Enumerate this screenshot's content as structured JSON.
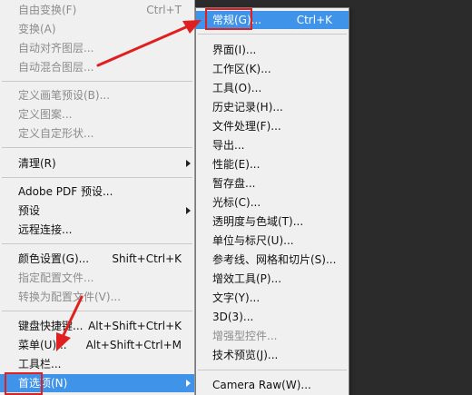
{
  "edit_menu": {
    "items": [
      {
        "label": "自由变换(F)",
        "shortcut": "Ctrl+T",
        "disabled": true
      },
      {
        "label": "变换(A)",
        "disabled": true
      },
      {
        "label": "自动对齐图层...",
        "disabled": true
      },
      {
        "label": "自动混合图层...",
        "disabled": true
      },
      {
        "label": "定义画笔预设(B)...",
        "disabled": true
      },
      {
        "label": "定义图案...",
        "disabled": true
      },
      {
        "label": "定义自定形状...",
        "disabled": true
      },
      {
        "label": "清理(R)",
        "submenu": true
      },
      {
        "label": "Adobe PDF 预设..."
      },
      {
        "label": "预设",
        "submenu": true
      },
      {
        "label": "远程连接..."
      },
      {
        "label": "颜色设置(G)...",
        "shortcut": "Shift+Ctrl+K"
      },
      {
        "label": "指定配置文件...",
        "disabled": true
      },
      {
        "label": "转换为配置文件(V)...",
        "disabled": true
      },
      {
        "label": "键盘快捷键...",
        "shortcut": "Alt+Shift+Ctrl+K"
      },
      {
        "label": "菜单(U)...",
        "shortcut": "Alt+Shift+Ctrl+M"
      },
      {
        "label": "工具栏..."
      },
      {
        "label": "首选项(N)",
        "submenu": true,
        "highlighted": true
      }
    ]
  },
  "preferences_menu": {
    "items": [
      {
        "label": "常规(G)...",
        "shortcut": "Ctrl+K",
        "highlighted": true
      },
      {
        "label": "界面(I)..."
      },
      {
        "label": "工作区(K)..."
      },
      {
        "label": "工具(O)..."
      },
      {
        "label": "历史记录(H)..."
      },
      {
        "label": "文件处理(F)..."
      },
      {
        "label": "导出..."
      },
      {
        "label": "性能(E)..."
      },
      {
        "label": "暂存盘..."
      },
      {
        "label": "光标(C)..."
      },
      {
        "label": "透明度与色域(T)..."
      },
      {
        "label": "单位与标尺(U)..."
      },
      {
        "label": "参考线、网格和切片(S)..."
      },
      {
        "label": "增效工具(P)..."
      },
      {
        "label": "文字(Y)..."
      },
      {
        "label": "3D(3)..."
      },
      {
        "label": "增强型控件...",
        "disabled": true
      },
      {
        "label": "技术预览(J)..."
      },
      {
        "label": "Camera Raw(W)..."
      }
    ]
  },
  "colors": {
    "highlight": "#3f93e8",
    "annotation": "#e02020",
    "disabled_text": "#8c8c8c"
  }
}
